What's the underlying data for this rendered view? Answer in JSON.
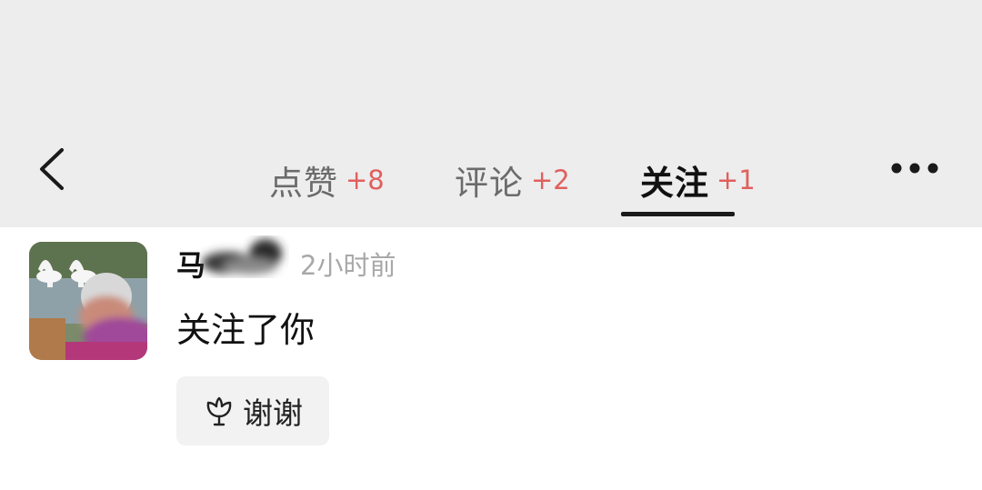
{
  "header": {
    "back_icon": "chevron-left-icon",
    "more_icon": "more-horizontal-icon",
    "tabs": [
      {
        "label": "点赞",
        "count": "+8",
        "active": false
      },
      {
        "label": "评论",
        "count": "+2",
        "active": false
      },
      {
        "label": "关注",
        "count": "+1",
        "active": true
      }
    ]
  },
  "notification": {
    "username": "马",
    "time": "2小时前",
    "message": "关注了你",
    "thanks_button": {
      "icon": "flower-icon",
      "label": "谢谢"
    }
  },
  "colors": {
    "header_bg": "#ededed",
    "count_accent": "#e0605e",
    "timestamp": "#a8a8a8",
    "button_bg": "#f2f2f2"
  }
}
